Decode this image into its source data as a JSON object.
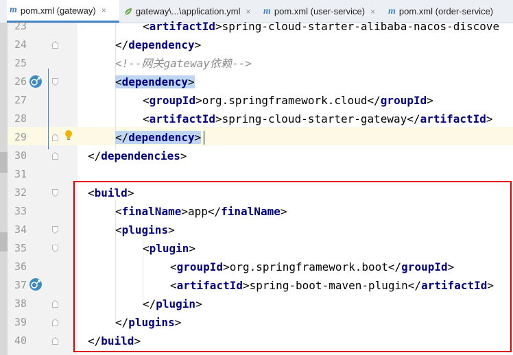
{
  "tabs": [
    {
      "label": "pom.xml (gateway)",
      "icon": "m-icon",
      "active": true
    },
    {
      "label": "gateway\\...\\application.yml",
      "icon": "leaf-icon",
      "active": false
    },
    {
      "label": "pom.xml (user-service)",
      "icon": "m-icon",
      "active": false
    },
    {
      "label": "pom.xml (order-service)",
      "icon": "m-icon",
      "active": false
    }
  ],
  "tab_icon_letter": "m",
  "close_glyph": "×",
  "editor": {
    "lines": [
      {
        "num": "23",
        "text": "<artifactId>spring-cloud-starter-alibaba-nacos-discove"
      },
      {
        "num": "24",
        "text": "</dependency>"
      },
      {
        "num": "25",
        "text": "<!--网关gateway依赖-->"
      },
      {
        "num": "26",
        "text": "<dependency>"
      },
      {
        "num": "27",
        "text": "<groupId>org.springframework.cloud</groupId>"
      },
      {
        "num": "28",
        "text": "<artifactId>spring-cloud-starter-gateway</artifactId>"
      },
      {
        "num": "29",
        "text": "</dependency>"
      },
      {
        "num": "30",
        "text": "</dependencies>"
      },
      {
        "num": "31",
        "text": ""
      },
      {
        "num": "32",
        "text": "<build>"
      },
      {
        "num": "33",
        "text": "<finalName>app</finalName>"
      },
      {
        "num": "34",
        "text": "<plugins>"
      },
      {
        "num": "35",
        "text": "<plugin>"
      },
      {
        "num": "36",
        "text": "<groupId>org.springframework.boot</groupId>"
      },
      {
        "num": "37",
        "text": "<artifactId>spring-boot-maven-plugin</artifactId>"
      },
      {
        "num": "38",
        "text": "</plugin>"
      },
      {
        "num": "39",
        "text": "</plugins>"
      },
      {
        "num": "40",
        "text": "</build>"
      }
    ]
  },
  "colors": {
    "accent": "#4083c9",
    "tag": "#000080",
    "highlight": "#bed6f2",
    "current_line": "#fcfae4",
    "annotation_box": "#e00000"
  }
}
